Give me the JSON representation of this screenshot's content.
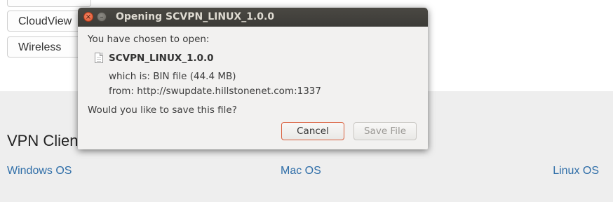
{
  "page": {
    "sidebar_buttons": [
      "CloudView",
      "Wireless"
    ],
    "section_title": "VPN Client",
    "os_links": {
      "windows": "Windows OS",
      "mac": "Mac OS",
      "linux": "Linux OS"
    }
  },
  "dialog": {
    "title": "Opening SCVPN_LINUX_1.0.0",
    "close_glyph": "×",
    "minimize_glyph": "–",
    "prompt": "You have chosen to open:",
    "file_icon": "file-icon",
    "filename": "SCVPN_LINUX_1.0.0",
    "which_is": "which is:  BIN file (44.4 MB)",
    "from": "from:  http://swupdate.hillstonenet.com:1337",
    "question": "Would you like to save this file?",
    "cancel_label": "Cancel",
    "save_label": "Save File"
  },
  "colors": {
    "link": "#2f6ea8",
    "titlebar": "#3c3b37",
    "close_button": "#e0522b",
    "focus_border": "#d9603e"
  }
}
